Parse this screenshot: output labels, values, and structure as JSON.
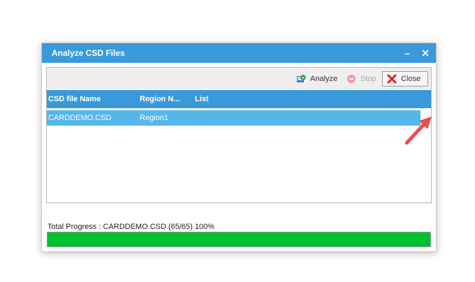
{
  "window": {
    "title": "Analyze CSD Files",
    "minimize_glyph": "–",
    "close_glyph": "✕"
  },
  "toolbar": {
    "analyze_label": "Analyze",
    "stop_label": "Stop",
    "close_label": "Close",
    "analyze_icon": "analyze-icon",
    "stop_icon": "stop-icon",
    "close_icon": "red-x-icon"
  },
  "grid": {
    "columns": [
      "CSD file Name",
      "Region N...",
      "List"
    ],
    "rows": [
      {
        "csd_file_name": "CARDDEMO.CSD",
        "region": "Region1",
        "list": ""
      }
    ]
  },
  "status": {
    "progress_text": "Total Progress : CARDDEMO.CSD (65/65) 100%",
    "progress_fraction": 1.0
  },
  "colors": {
    "titlebar": "#3a9ad9",
    "grid_header": "#3a9ad9",
    "selected_row": "#55b6ec",
    "progress_fill": "#00c030",
    "annotation_arrow": "#ef4b4b"
  }
}
